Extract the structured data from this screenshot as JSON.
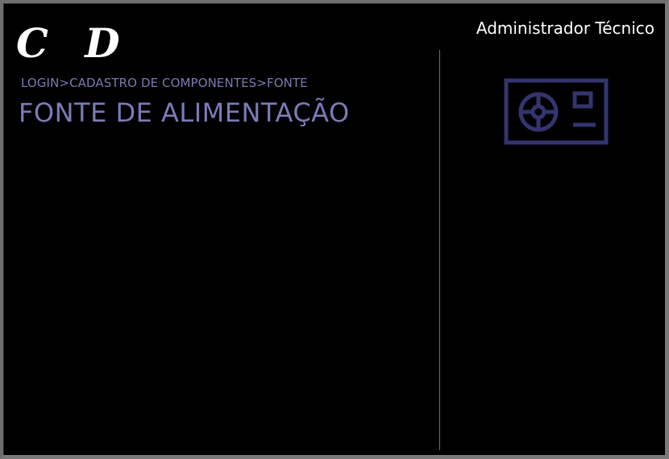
{
  "header": {
    "logo_text": "C D",
    "user_name": "Administrador Técnico"
  },
  "breadcrumb": {
    "items": [
      "LOGIN",
      "CADASTRO DE COMPONENTES",
      "FONTE"
    ],
    "separator": ">"
  },
  "page": {
    "title": "FONTE DE ALIMENTAÇÃO",
    "icon": "power-supply-icon"
  },
  "colors": {
    "background": "#000000",
    "accent": "#7b7bb8",
    "icon": "#34346e",
    "text_white": "#ffffff"
  }
}
